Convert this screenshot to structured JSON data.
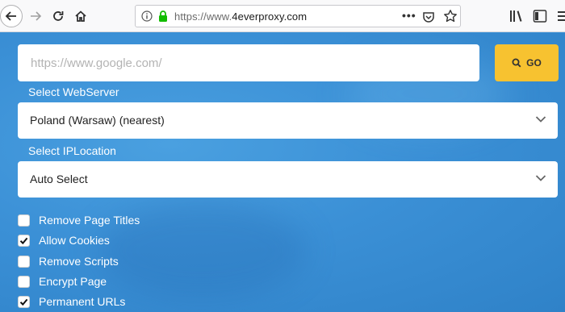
{
  "browser": {
    "url_prefix": "https://www.",
    "url_domain": "4everproxy.com",
    "more_label": "•••"
  },
  "form": {
    "url_placeholder": "https://www.google.com/",
    "go_label": "GO",
    "webserver_label": "Select WebServer",
    "webserver_value": "Poland (Warsaw) (nearest)",
    "iplocation_label": "Select IPLocation",
    "iplocation_value": "Auto Select"
  },
  "options": [
    {
      "label": "Remove Page Titles",
      "checked": false
    },
    {
      "label": "Allow Cookies",
      "checked": true
    },
    {
      "label": "Remove Scripts",
      "checked": false
    },
    {
      "label": "Encrypt Page",
      "checked": false
    },
    {
      "label": "Permanent URLs",
      "checked": true
    }
  ],
  "colors": {
    "accent_go": "#f7c230",
    "page_bg": "#3a8fd6",
    "secure_lock": "#12bc00"
  }
}
